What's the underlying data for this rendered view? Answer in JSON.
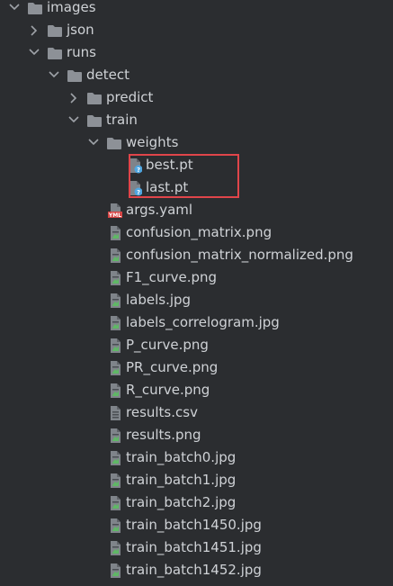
{
  "tree": [
    {
      "label": "images",
      "depth": 0,
      "kind": "folder",
      "expanded": true
    },
    {
      "label": "json",
      "depth": 1,
      "kind": "folder",
      "expanded": false
    },
    {
      "label": "runs",
      "depth": 1,
      "kind": "folder",
      "expanded": true
    },
    {
      "label": "detect",
      "depth": 2,
      "kind": "folder",
      "expanded": true
    },
    {
      "label": "predict",
      "depth": 3,
      "kind": "folder",
      "expanded": false
    },
    {
      "label": "train",
      "depth": 3,
      "kind": "folder",
      "expanded": true
    },
    {
      "label": "weights",
      "depth": 4,
      "kind": "folder",
      "expanded": true
    },
    {
      "label": "best.pt",
      "depth": 5,
      "kind": "unknown-file"
    },
    {
      "label": "last.pt",
      "depth": 5,
      "kind": "unknown-file"
    },
    {
      "label": "args.yaml",
      "depth": 4,
      "kind": "yaml-file",
      "badge": "YML"
    },
    {
      "label": "confusion_matrix.png",
      "depth": 4,
      "kind": "image-file"
    },
    {
      "label": "confusion_matrix_normalized.png",
      "depth": 4,
      "kind": "image-file"
    },
    {
      "label": "F1_curve.png",
      "depth": 4,
      "kind": "image-file"
    },
    {
      "label": "labels.jpg",
      "depth": 4,
      "kind": "image-file"
    },
    {
      "label": "labels_correlogram.jpg",
      "depth": 4,
      "kind": "image-file"
    },
    {
      "label": "P_curve.png",
      "depth": 4,
      "kind": "image-file"
    },
    {
      "label": "PR_curve.png",
      "depth": 4,
      "kind": "image-file"
    },
    {
      "label": "R_curve.png",
      "depth": 4,
      "kind": "image-file"
    },
    {
      "label": "results.csv",
      "depth": 4,
      "kind": "text-file"
    },
    {
      "label": "results.png",
      "depth": 4,
      "kind": "image-file"
    },
    {
      "label": "train_batch0.jpg",
      "depth": 4,
      "kind": "image-file"
    },
    {
      "label": "train_batch1.jpg",
      "depth": 4,
      "kind": "image-file"
    },
    {
      "label": "train_batch2.jpg",
      "depth": 4,
      "kind": "image-file"
    },
    {
      "label": "train_batch1450.jpg",
      "depth": 4,
      "kind": "image-file"
    },
    {
      "label": "train_batch1451.jpg",
      "depth": 4,
      "kind": "image-file"
    },
    {
      "label": "train_batch1452.jpg",
      "depth": 4,
      "kind": "image-file"
    }
  ],
  "highlighted_items": [
    "best.pt",
    "last.pt"
  ],
  "colors": {
    "background": "#2b2d30",
    "text": "#cfd2d6",
    "folder": "#8d9197",
    "chevron": "#9ea2a8",
    "highlight_border": "#e0454a",
    "yml_badge": "#d64545",
    "image_icon_accent": "#5fb865",
    "unknown_icon_accent": "#4fa6e0"
  }
}
